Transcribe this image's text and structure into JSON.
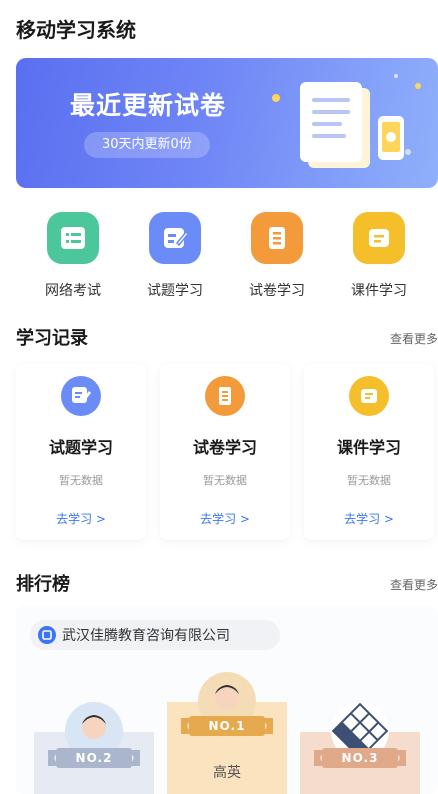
{
  "app": {
    "title": "移动学习系统"
  },
  "banner": {
    "title": "最近更新试卷",
    "subtitle": "30天内更新0份",
    "colors": {
      "from": "#5a6ff0",
      "to": "#8fb0fb"
    }
  },
  "quick_nav": [
    {
      "label": "网络考试",
      "icon": "list-icon",
      "color": "#4cc79b"
    },
    {
      "label": "试题学习",
      "icon": "edit-note-icon",
      "color": "#6b8cf6"
    },
    {
      "label": "试卷学习",
      "icon": "document-icon",
      "color": "#f39a3b"
    },
    {
      "label": "课件学习",
      "icon": "folder-icon",
      "color": "#f5bf2b"
    }
  ],
  "records": {
    "title": "学习记录",
    "more": "查看更多",
    "items": [
      {
        "title": "试题学习",
        "status": "暂无数据",
        "link": "去学习 >",
        "icon": "edit-note-icon",
        "color": "#6b8cf6"
      },
      {
        "title": "试卷学习",
        "status": "暂无数据",
        "link": "去学习 >",
        "icon": "document-icon",
        "color": "#f39a3b"
      },
      {
        "title": "课件学习",
        "status": "暂无数据",
        "link": "去学习 >",
        "icon": "folder-icon",
        "color": "#f5bf2b"
      }
    ]
  },
  "ranking": {
    "title": "排行榜",
    "more": "查看更多",
    "organization": "武汉佳腾教育咨询有限公司",
    "entries": [
      {
        "rank": "NO.2",
        "name": "",
        "base_color": "#e6ebf3",
        "ribbon_color": "#a9b6cc"
      },
      {
        "rank": "NO.1",
        "name": "高英",
        "base_color": "#fbe3bf",
        "ribbon_color": "#e6a94e"
      },
      {
        "rank": "NO.3",
        "name": "",
        "base_color": "#f6dccd",
        "ribbon_color": "#dfa98a"
      }
    ]
  }
}
